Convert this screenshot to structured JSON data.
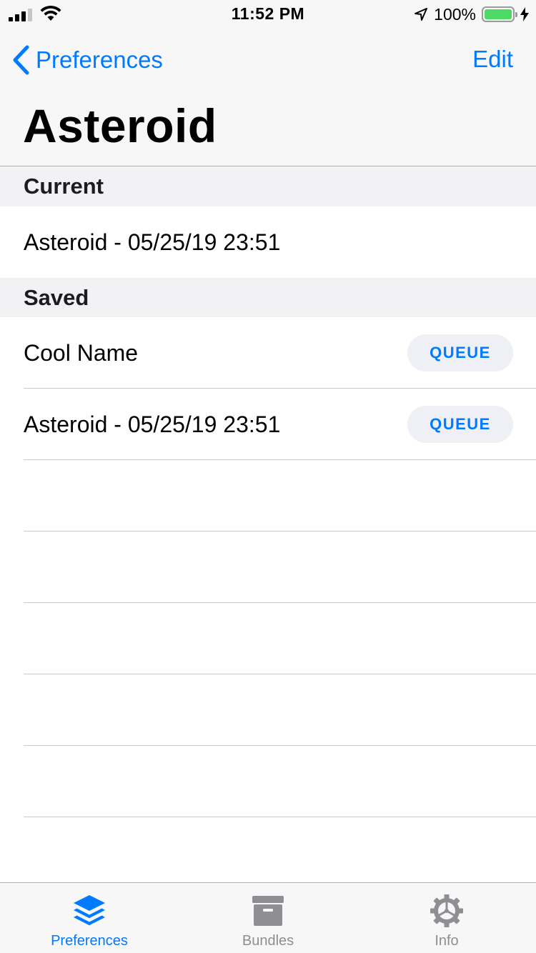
{
  "status_bar": {
    "time": "11:52 PM",
    "battery_percent": "100%",
    "battery_level": 1.0,
    "signal_bars": 3,
    "icons": [
      "signal-icon",
      "wifi-icon",
      "location-arrow-icon",
      "battery-icon",
      "charging-bolt-icon"
    ]
  },
  "nav": {
    "back_label": "Preferences",
    "edit_label": "Edit",
    "title": "Asteroid"
  },
  "sections": {
    "current": {
      "header": "Current",
      "items": [
        {
          "label": "Asteroid - 05/25/19 23:51"
        }
      ]
    },
    "saved": {
      "header": "Saved",
      "items": [
        {
          "label": "Cool Name",
          "action": "QUEUE"
        },
        {
          "label": "Asteroid - 05/25/19 23:51",
          "action": "QUEUE"
        }
      ]
    }
  },
  "tab_bar": {
    "tabs": [
      {
        "label": "Preferences",
        "icon": "layers-icon",
        "selected": true
      },
      {
        "label": "Bundles",
        "icon": "archive-box-icon",
        "selected": false
      },
      {
        "label": "Info",
        "icon": "gear-icon",
        "selected": false
      }
    ]
  },
  "colors": {
    "accent": "#007aff",
    "inactive_tab": "#8e8e93",
    "battery_fill": "#4cd964",
    "bar_background": "#f7f7f7",
    "section_background": "#f2f2f4",
    "queue_button_background": "#eff0f5"
  }
}
